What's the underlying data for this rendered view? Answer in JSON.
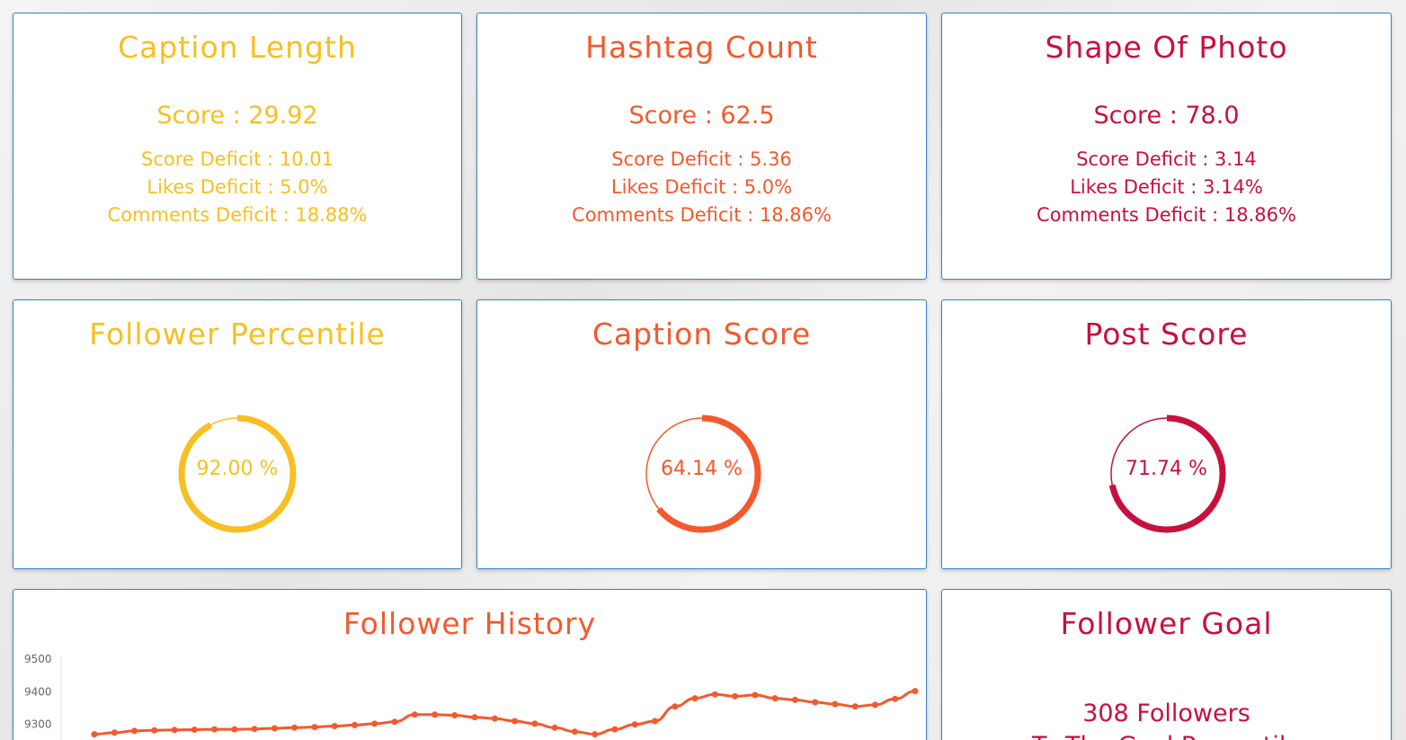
{
  "colors": {
    "yellow": "#f7bf22",
    "orange": "#f4592e",
    "crimson": "#c8103e",
    "card_border": "#3b82c4"
  },
  "caption_length": {
    "title": "Caption Length",
    "score": "Score : 29.92",
    "score_deficit": "Score Deficit : 10.01",
    "likes_deficit": "Likes Deficit : 5.0%",
    "comments_deficit": "Comments Deficit : 18.88%"
  },
  "hashtag_count": {
    "title": "Hashtag Count",
    "score": "Score : 62.5",
    "score_deficit": "Score Deficit : 5.36",
    "likes_deficit": "Likes Deficit : 5.0%",
    "comments_deficit": "Comments Deficit : 18.86%"
  },
  "shape_of_photo": {
    "title": "Shape Of Photo",
    "score": "Score : 78.0",
    "score_deficit": "Score Deficit : 3.14",
    "likes_deficit": "Likes Deficit : 3.14%",
    "comments_deficit": "Comments Deficit : 18.86%"
  },
  "follower_percentile": {
    "title": "Follower Percentile",
    "value_text": "92.00 %",
    "value": 0.92
  },
  "caption_score": {
    "title": "Caption Score",
    "value_text": "64.14 %",
    "value": 0.6414
  },
  "post_score": {
    "title": "Post Score",
    "value_text": "71.74 %",
    "value": 0.7174
  },
  "follower_history": {
    "title": "Follower History"
  },
  "chart_data": {
    "type": "line",
    "title": "Follower History",
    "xlabel": "",
    "ylabel": "",
    "yticks": [
      "9500",
      "9400",
      "9300"
    ],
    "ylim": [
      9200,
      9500
    ],
    "grid": false,
    "series": [
      {
        "values": [
          9270,
          9275,
          9280,
          9282,
          9283,
          9284,
          9285,
          9285,
          9286,
          9288,
          9290,
          9292,
          9295,
          9298,
          9302,
          9308,
          9330,
          9330,
          9328,
          9322,
          9318,
          9310,
          9302,
          9290,
          9278,
          9270,
          9285,
          9300,
          9310,
          9355,
          9380,
          9392,
          9386,
          9390,
          9380,
          9375,
          9368,
          9362,
          9355,
          9360,
          9378,
          9402
        ]
      }
    ]
  },
  "follower_goal": {
    "title": "Follower Goal",
    "followers_text": "308 Followers",
    "subtext": "To The Goal Percentile"
  }
}
